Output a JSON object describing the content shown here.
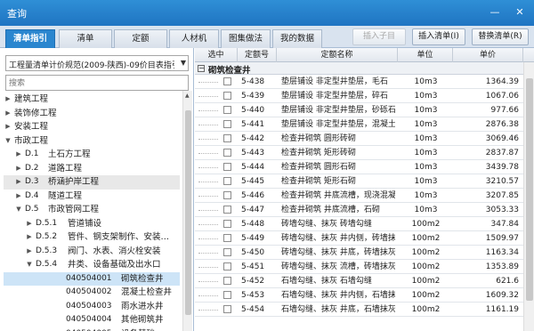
{
  "window": {
    "title": "查询",
    "min_glyph": "—",
    "close_glyph": "✕"
  },
  "tabs": [
    {
      "label": "清单指引",
      "active": true
    },
    {
      "label": "清单",
      "active": false
    },
    {
      "label": "定额",
      "active": false
    },
    {
      "label": "人材机",
      "active": false
    },
    {
      "label": "图集做法",
      "active": false
    },
    {
      "label": "我的数据",
      "active": false
    }
  ],
  "toolbar": {
    "insert_sub": "插入子目",
    "insert_list": "插入清单(I)",
    "replace_list": "替换清单(R)"
  },
  "left": {
    "dropdown_value": "工程量清单计价规范(2009-陕西)-09价目表指引",
    "search_placeholder": "搜索"
  },
  "tree": [
    {
      "code": "",
      "label": "建筑工程",
      "exp": "▶",
      "level": 0
    },
    {
      "code": "",
      "label": "装饰修工程",
      "exp": "▶",
      "level": 0
    },
    {
      "code": "",
      "label": "安装工程",
      "exp": "▶",
      "level": 0
    },
    {
      "code": "",
      "label": "市政工程",
      "exp": "▼",
      "level": 0
    },
    {
      "code": "D.1",
      "label": "土石方工程",
      "exp": "▶",
      "level": 1
    },
    {
      "code": "D.2",
      "label": "道路工程",
      "exp": "▶",
      "level": 1
    },
    {
      "code": "D.3",
      "label": "桥涵护岸工程",
      "exp": "▶",
      "level": 1,
      "hl": true
    },
    {
      "code": "D.4",
      "label": "隧道工程",
      "exp": "▶",
      "level": 1
    },
    {
      "code": "D.5",
      "label": "市政管网工程",
      "exp": "▼",
      "level": 1
    },
    {
      "code": "D.5.1",
      "label": "管道铺设",
      "exp": "▶",
      "level": 2
    },
    {
      "code": "D.5.2",
      "label": "管件、钢支架制作、安装…",
      "exp": "▶",
      "level": 2
    },
    {
      "code": "D.5.3",
      "label": "阀门、水表、消火栓安装",
      "exp": "▶",
      "level": 2
    },
    {
      "code": "D.5.4",
      "label": "井类、设备基础及出水口",
      "exp": "▼",
      "level": 2
    },
    {
      "code": "040504001",
      "label": "砌筑检查井",
      "exp": "",
      "level": 3,
      "sel": true
    },
    {
      "code": "040504002",
      "label": "混凝土检查井",
      "exp": "",
      "level": 3
    },
    {
      "code": "040504003",
      "label": "雨水进水井",
      "exp": "",
      "level": 3
    },
    {
      "code": "040504004",
      "label": "其他砌筑井",
      "exp": "",
      "level": 3
    },
    {
      "code": "040504005",
      "label": "设备基础",
      "exp": "",
      "level": 3
    }
  ],
  "table": {
    "headers": {
      "select": "选中",
      "code": "定额号",
      "name": "定额名称",
      "unit": "单位",
      "price": "单价"
    },
    "group_toggle": "−",
    "group_label": "砌筑检查井",
    "rows": [
      {
        "code": "5-438",
        "name": "垫层铺设 非定型井垫层，毛石",
        "unit": "10m3",
        "price": "1364.39"
      },
      {
        "code": "5-439",
        "name": "垫层铺设 非定型井垫层，碎石",
        "unit": "10m3",
        "price": "1067.06"
      },
      {
        "code": "5-440",
        "name": "垫层铺设 非定型井垫层，砂砾石",
        "unit": "10m3",
        "price": "977.66"
      },
      {
        "code": "5-441",
        "name": "垫层铺设 非定型井垫层，混凝土",
        "unit": "10m3",
        "price": "2876.38"
      },
      {
        "code": "5-442",
        "name": "检查井砌筑 圆形砖砌",
        "unit": "10m3",
        "price": "3069.46"
      },
      {
        "code": "5-443",
        "name": "检查井砌筑 矩形砖砌",
        "unit": "10m3",
        "price": "2837.87"
      },
      {
        "code": "5-444",
        "name": "检查井砌筑 圆形石砌",
        "unit": "10m3",
        "price": "3439.78"
      },
      {
        "code": "5-445",
        "name": "检查井砌筑 矩形石砌",
        "unit": "10m3",
        "price": "3210.57"
      },
      {
        "code": "5-446",
        "name": "检查井砌筑 井底流槽，现浇混凝土",
        "unit": "10m3",
        "price": "3207.85"
      },
      {
        "code": "5-447",
        "name": "检查井砌筑 井底流槽，石砌",
        "unit": "10m3",
        "price": "3053.33"
      },
      {
        "code": "5-448",
        "name": "砖墙勾缝、抹灰 砖墙勾缝",
        "unit": "100m2",
        "price": "347.84"
      },
      {
        "code": "5-449",
        "name": "砖墙勾缝、抹灰 井内侧，砖墙抹灰",
        "unit": "100m2",
        "price": "1509.97"
      },
      {
        "code": "5-450",
        "name": "砖墙勾缝、抹灰 井底，砖墙抹灰",
        "unit": "100m2",
        "price": "1163.34"
      },
      {
        "code": "5-451",
        "name": "砖墙勾缝、抹灰 流槽，砖墙抹灰",
        "unit": "100m2",
        "price": "1353.89"
      },
      {
        "code": "5-452",
        "name": "石墙勾缝、抹灰 石墙勾缝",
        "unit": "100m2",
        "price": "621.6"
      },
      {
        "code": "5-453",
        "name": "石墙勾缝、抹灰 井内侧，石墙抹灰",
        "unit": "100m2",
        "price": "1609.32"
      },
      {
        "code": "5-454",
        "name": "石墙勾缝、抹灰 井底，石墙抹灰",
        "unit": "100m2",
        "price": "1161.19"
      }
    ]
  },
  "colors": {
    "titlebar": "#2a86cf",
    "selected_row": "#cde4f7"
  }
}
